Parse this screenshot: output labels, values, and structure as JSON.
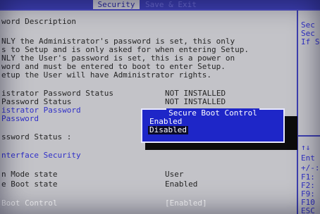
{
  "header": {
    "tabs": [
      "Security",
      "Save & Exit"
    ],
    "active_tab_index": 0
  },
  "description": {
    "title": "word Description",
    "lines": [
      "NLY the Administrator's password is set, this only",
      "s to Setup and is only asked for when entering Setup.",
      "NLY the User's password is set, this is a power on",
      "word and must be entered to boot to enter Setup.",
      "etup the User will have Administrator rights."
    ]
  },
  "settings": [
    {
      "label": "istrator Password Status",
      "value": "NOT INSTALLED"
    },
    {
      "label": "Password Status",
      "value": "NOT INSTALLED"
    },
    {
      "label": "istrator Password",
      "value": ""
    },
    {
      "label": "Password",
      "value": ""
    },
    {
      "label": "ssword Status  :",
      "value": ""
    },
    {
      "label": "nterface Security",
      "value": ""
    },
    {
      "label": "n Mode state",
      "value": "User"
    },
    {
      "label": "e Boot state",
      "value": "Enabled"
    },
    {
      "label": "Boot Control",
      "value": "[Enabled]"
    }
  ],
  "popup": {
    "title": "Secure Boot Control",
    "options": [
      "Enabled",
      "Disabled"
    ],
    "selected_index": 1
  },
  "right_help": {
    "top_lines": [
      "Sec",
      "Sec",
      "If S"
    ],
    "keys": [
      "Ent",
      "+/-:",
      "F1:",
      "F2:",
      "F9:",
      "F10",
      "ESC"
    ]
  }
}
